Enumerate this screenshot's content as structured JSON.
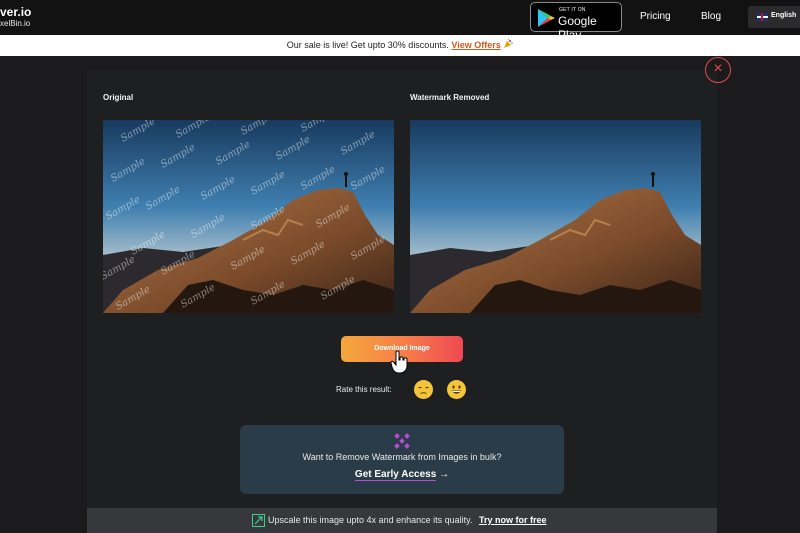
{
  "header": {
    "logo_line1": "ver.io",
    "logo_line2": "xelBin.io",
    "google_play": {
      "small": "GET IT ON",
      "big": "Google Play"
    },
    "nav": [
      {
        "label": "Pricing"
      },
      {
        "label": "Blog"
      }
    ],
    "language": "English"
  },
  "promo": {
    "text": "Our sale is live! Get upto 30% discounts.",
    "link": "View Offers"
  },
  "modal": {
    "left_title": "Original",
    "right_title": "Watermark Removed",
    "watermark_text": "Sample",
    "download_label": "Download Image",
    "rate_label": "Rate this result:",
    "emojis": [
      "unamused-face-icon",
      "grinning-face-icon"
    ],
    "bulk": {
      "question": "Want to Remove Watermark from Images in bulk?",
      "cta": "Get Early Access",
      "arrow": "→"
    },
    "upscale": {
      "text": "Upscale this image upto 4x and enhance its quality.",
      "link": "Try now for free"
    },
    "close_glyph": "×"
  },
  "colors": {
    "accent_red": "#e5484d",
    "promo_link": "#d5581c",
    "button_gradient": [
      "#f5a83c",
      "#f04852"
    ],
    "bulk_bg": "#2a3c47"
  }
}
